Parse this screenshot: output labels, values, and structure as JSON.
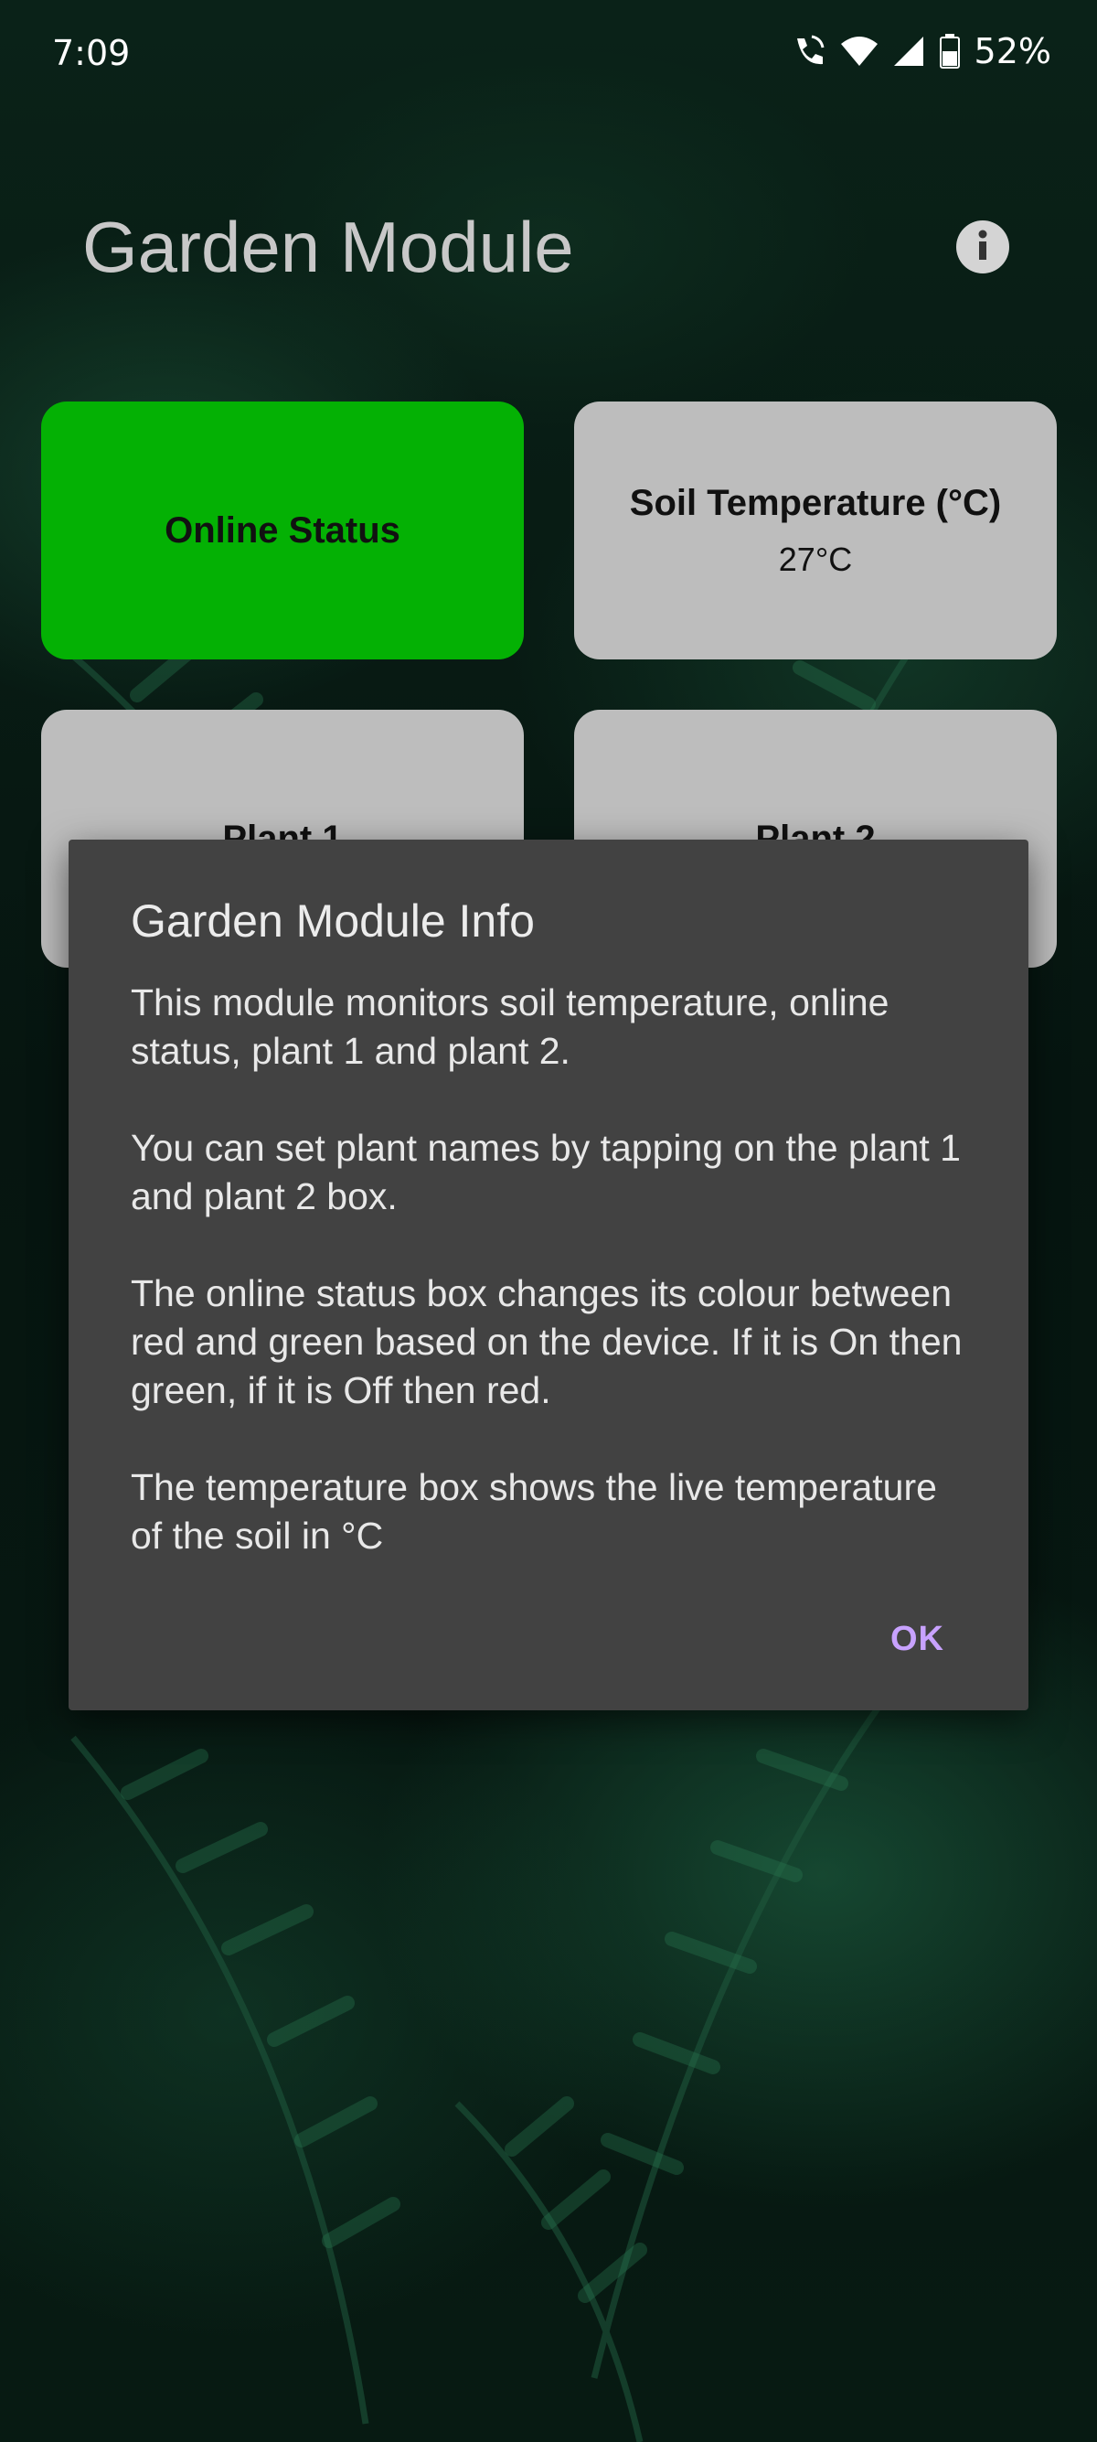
{
  "status_bar": {
    "time": "7:09",
    "battery": "52%",
    "icons": [
      "wifi-calling-icon",
      "wifi-icon",
      "signal-icon",
      "battery-icon"
    ]
  },
  "header": {
    "title": "Garden Module",
    "info_icon": "info-icon"
  },
  "tiles": {
    "online_status": {
      "title": "Online Status",
      "color": "#04b104"
    },
    "soil_temperature": {
      "title": "Soil Temperature (°C)",
      "value": "27°C"
    },
    "plant1": {
      "title": "Plant 1"
    },
    "plant2": {
      "title": "Plant 2"
    }
  },
  "dialog": {
    "title": "Garden Module Info",
    "paragraphs": [
      "This module monitors soil temperature, online status, plant 1 and plant 2.",
      "You can set plant names by tapping on the plant 1 and plant 2 box.",
      "The online status box changes its colour between red and green based on the device. If it is On then green, if it is Off then red.",
      "The temperature box shows the live temperature of the soil in °C"
    ],
    "ok_label": "OK",
    "accent": "#c8a2ff"
  }
}
